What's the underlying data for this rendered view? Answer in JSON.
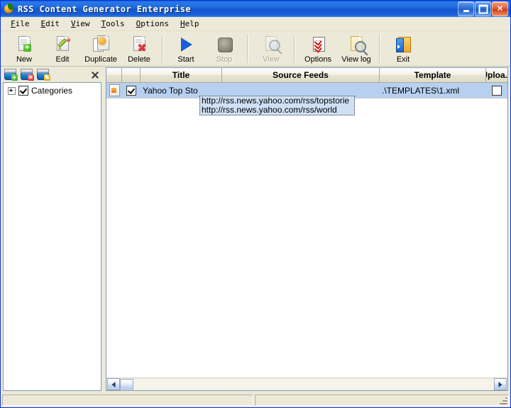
{
  "window": {
    "title": "RSS Content Generator Enterprise",
    "icon": "rss-globe-icon",
    "caption_buttons": [
      {
        "name": "minimize",
        "label": "_"
      },
      {
        "name": "restore",
        "label": "□"
      },
      {
        "name": "close",
        "label": "×"
      }
    ]
  },
  "menubar": {
    "items": [
      {
        "accel": "F",
        "rest": "ile"
      },
      {
        "accel": "E",
        "rest": "dit"
      },
      {
        "accel": "V",
        "rest": "iew"
      },
      {
        "accel": "T",
        "rest": "ools"
      },
      {
        "accel": "O",
        "rest": "ptions"
      },
      {
        "accel": "H",
        "rest": "elp"
      }
    ]
  },
  "toolbar": {
    "buttons": [
      {
        "label": "New",
        "icon": "new-document-icon",
        "enabled": true
      },
      {
        "label": "Edit",
        "icon": "edit-pencil-icon",
        "enabled": true
      },
      {
        "label": "Duplicate",
        "icon": "duplicate-icon",
        "enabled": true
      },
      {
        "label": "Delete",
        "icon": "delete-icon",
        "enabled": true
      },
      {
        "label": "Start",
        "icon": "play-icon",
        "enabled": true
      },
      {
        "label": "Stop",
        "icon": "stop-icon",
        "enabled": false
      },
      {
        "label": "View",
        "icon": "view-magnifier-icon",
        "enabled": false
      },
      {
        "label": "Options",
        "icon": "options-checklist-icon",
        "enabled": true
      },
      {
        "label": "View log",
        "icon": "view-log-icon",
        "enabled": true
      },
      {
        "label": "Exit",
        "icon": "exit-door-icon",
        "enabled": true
      }
    ]
  },
  "sidebar": {
    "tools": [
      {
        "name": "add-category-icon",
        "badge": "+"
      },
      {
        "name": "delete-category-icon",
        "badge": "x"
      },
      {
        "name": "edit-category-icon",
        "badge": "e"
      }
    ],
    "close_icon": "close-icon",
    "tree": {
      "nodes": [
        {
          "label": "Categories",
          "checked": true,
          "expanded": false
        }
      ]
    }
  },
  "grid": {
    "columns": [
      {
        "key": "icon",
        "label": ""
      },
      {
        "key": "enabled",
        "label": ""
      },
      {
        "key": "title",
        "label": "Title"
      },
      {
        "key": "feeds",
        "label": "Source Feeds"
      },
      {
        "key": "template",
        "label": "Template"
      },
      {
        "key": "upload",
        "label": "Uploa..."
      }
    ],
    "rows": [
      {
        "icon": "project-document-icon",
        "enabled": true,
        "title": "Yahoo Top Sto",
        "feeds": "",
        "template": ".\\TEMPLATES\\1.xml",
        "upload": false,
        "selected": true
      }
    ],
    "tooltip": {
      "lines": [
        "http://rss.news.yahoo.com/rss/topstorie",
        "http://rss.news.yahoo.com/rss/world"
      ]
    },
    "hscrollbar": {
      "left_arrow": "scroll-left-icon",
      "right_arrow": "scroll-right-icon"
    }
  },
  "statusbar": {
    "pane1": "",
    "pane2": ""
  }
}
